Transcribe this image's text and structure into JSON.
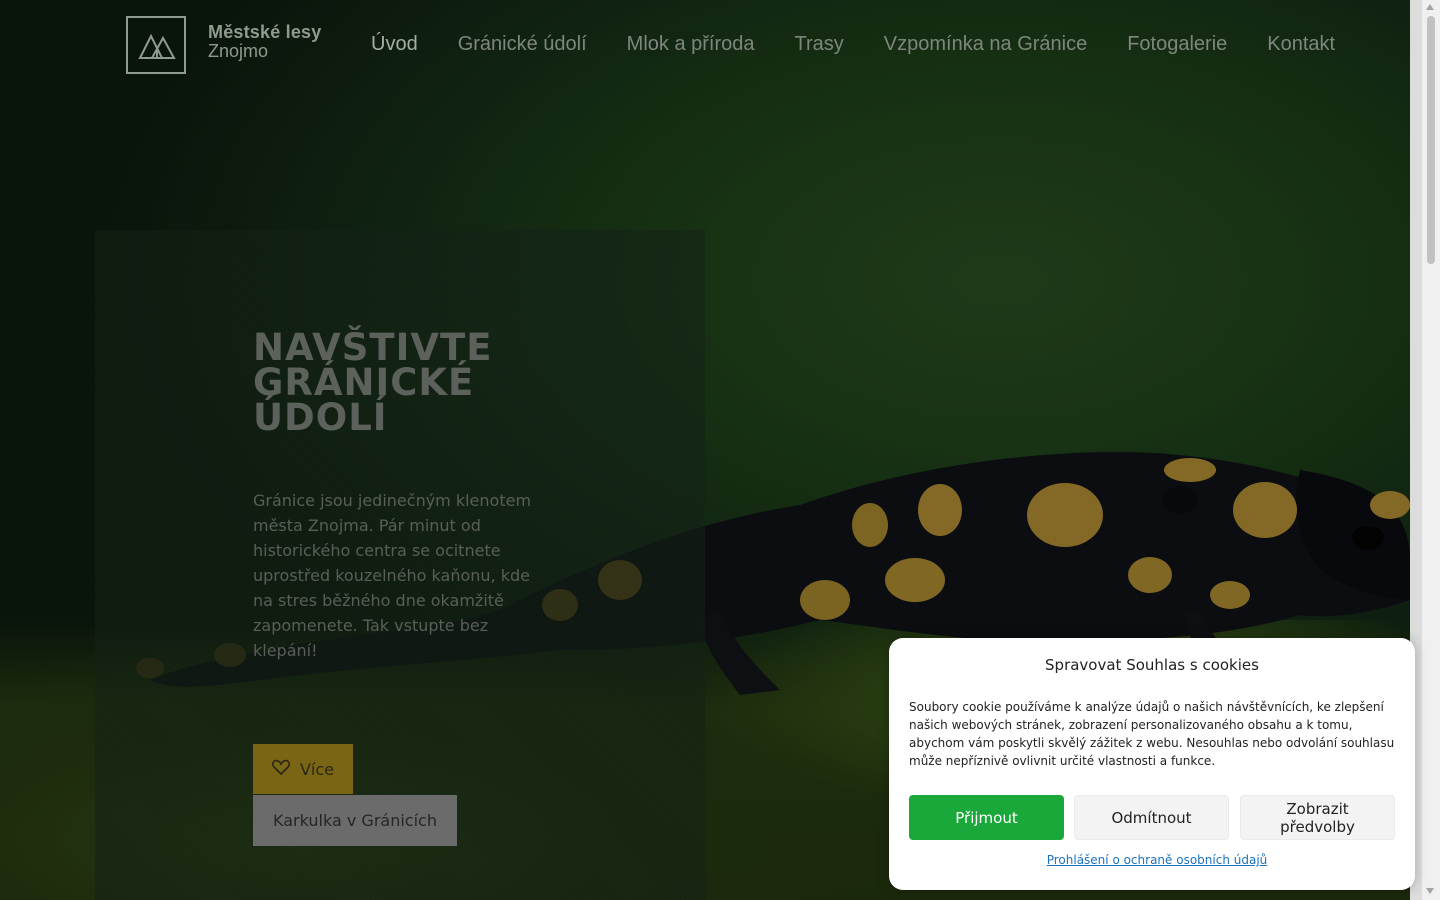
{
  "brand": {
    "line1": "Městské lesy",
    "line2": "Znojmo",
    "logo_icon": "mountain-logo-icon"
  },
  "nav": {
    "items": [
      {
        "label": "Úvod",
        "active": true
      },
      {
        "label": "Gránické údolí",
        "active": false
      },
      {
        "label": "Mlok a příroda",
        "active": false
      },
      {
        "label": "Trasy",
        "active": false
      },
      {
        "label": "Vzpomínka na Gránice",
        "active": false
      },
      {
        "label": "Fotogalerie",
        "active": false
      },
      {
        "label": "Kontakt",
        "active": false
      }
    ]
  },
  "hero": {
    "headline": "Navštivte Gránické údolí",
    "lead": "Gránice jsou jedinečným klenotem města Znojma. Pár minut od historického centra se ocitnete uprostřed kouzelného kaňonu, kde na stres běžného dne okamžitě zapomenete. Tak vstupte bez klepání!",
    "btn_more": "Více",
    "btn_more_icon": "heart-icon",
    "btn_karkulka": "Karkulka v Gránicích"
  },
  "cookie": {
    "title": "Spravovat Souhlas s cookies",
    "text": "Soubory cookie používáme k analýze údajů o našich návštěvnících, ke zlepšení našich webových stránek, zobrazení personalizovaného obsahu a k tomu, abychom vám poskytli skvělý zážitek z webu. Nesouhlas nebo odvolání souhlasu může nepříznivě ovlivnit určité vlastnosti a funkce.",
    "accept": "Přijmout",
    "deny": "Odmítnout",
    "prefs": "Zobrazit předvolby",
    "privacy_link": "Prohlášení o ochraně osobních údajů"
  },
  "colors": {
    "accent_yellow": "#7a6514",
    "accept_green": "#1aa83a",
    "link_blue": "#1e73be"
  }
}
